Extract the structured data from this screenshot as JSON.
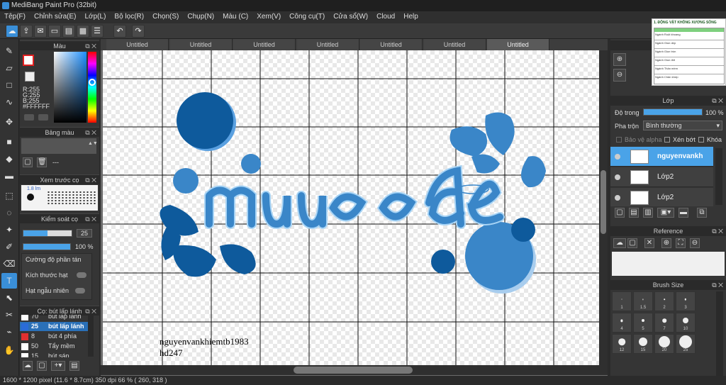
{
  "app": {
    "title": "MediBang Paint Pro (32bit)"
  },
  "menu": [
    "Tệp(F)",
    "Chỉnh sửa(E)",
    "Lớp(L)",
    "Bộ lọc(R)",
    "Chọn(S)",
    "Chụp(N)",
    "Màu (C)",
    "Xem(V)",
    "Công cụ(T)",
    "Cửa sổ(W)",
    "Cloud",
    "Help"
  ],
  "tabs": [
    "Untitled",
    "Untitled",
    "Untitled",
    "Untitled",
    "Untitled",
    "Untitled",
    "Untitled"
  ],
  "color_panel": {
    "title": "Màu",
    "r": "R:255",
    "g": "G:255",
    "b": "B:255",
    "hex": "#FFFFFF"
  },
  "palette_panel": {
    "title": "Bảng màu",
    "dash": "---"
  },
  "brush_preview": {
    "title": "Xem trước cọ",
    "size": "1.8 lm"
  },
  "brush_control": {
    "title": "Kiểm soát cọ",
    "size_value": "25",
    "opacity_value": "100 %",
    "opt1": "Cường độ phần tán",
    "opt2": "Kích thước hạt",
    "opt3": "Hạt ngẫu nhiên"
  },
  "brush_list": {
    "title": "Cọ: bút lấp lánh",
    "items": [
      {
        "num": "70",
        "name": "bút lấp lánh",
        "color": "#ffffff",
        "selected": false
      },
      {
        "num": "25",
        "name": "bút lấp lánh",
        "color": "#2a6cd8",
        "selected": true
      },
      {
        "num": "8",
        "name": "bút 4 phía",
        "color": "#e03030",
        "selected": false
      },
      {
        "num": "50",
        "name": "Tẩy mềm",
        "color": "#ffffff",
        "selected": false
      },
      {
        "num": "15",
        "name": "bút sáp",
        "color": "#ffffff",
        "selected": false
      }
    ]
  },
  "canvas": {
    "sign1": "nguyenvankhiemtb1983",
    "sign2": "hd247"
  },
  "layer_panel": {
    "title": "Lớp",
    "opacity_label": "Độ trong",
    "opacity_value": "100 %",
    "blend_label": "Pha trộn",
    "blend_value": "Bình thường",
    "protect_alpha": "Bảo vệ alpha",
    "clipping": "Xén bớt",
    "lock": "Khóa",
    "layers": [
      {
        "name": "nguyenvankh",
        "selected": true
      },
      {
        "name": "Lớp2",
        "selected": false
      },
      {
        "name": "Lớp2",
        "selected": false
      }
    ]
  },
  "reference_panel": {
    "title": "Reference"
  },
  "brush_size_panel": {
    "title": "Brush Size",
    "sizes": [
      "1",
      "1.5",
      "2",
      "3",
      "4",
      "5",
      "7",
      "10",
      "12",
      "15",
      "20",
      "25"
    ]
  },
  "navigator": {
    "title": "1. ĐỘNG VẬT KHÔNG XƯƠNG SỐNG",
    "col1": "Ngành Ruột khoang",
    "col2": "Ngành Giun dẹp",
    "col3": "Ngành Giun tròn",
    "col4": "Ngành Giun đốt",
    "col5": "Ngành Thân mềm",
    "col6": "Ngành Chân khớp"
  },
  "status": {
    "text": "1600 * 1200 pixel   (11.6 * 8.7cm)   350 dpi   66 %   ( 260, 318 )"
  },
  "colors": {
    "accent": "#4aa3e8",
    "drop": "#3a86c8",
    "dark_circle": "#0e5a9c"
  }
}
